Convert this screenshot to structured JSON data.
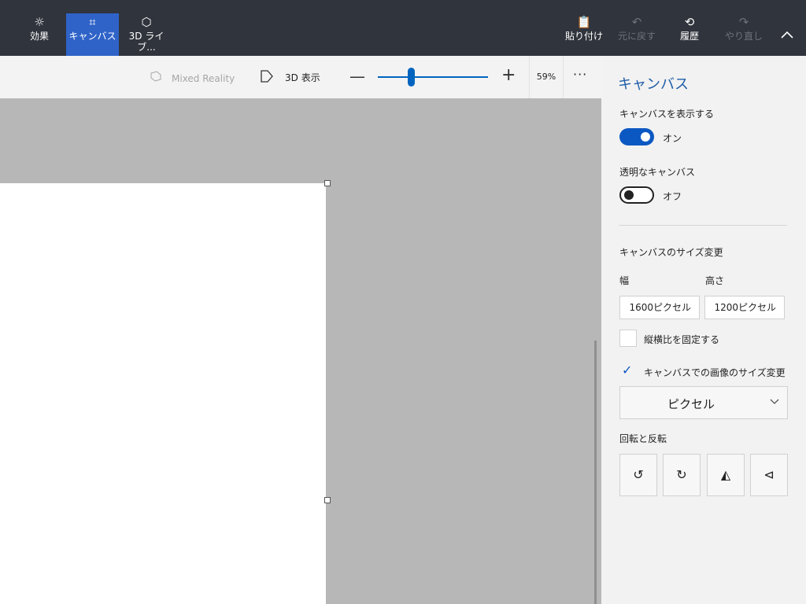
{
  "ribbon": {
    "tools": [
      {
        "label": "効果",
        "icon": "☼"
      },
      {
        "label": "キャンバス",
        "icon": "⌗"
      },
      {
        "label": "3D ライブ...",
        "icon": "⬡"
      }
    ],
    "actions": [
      {
        "label": "貼り付け",
        "icon": "📋"
      },
      {
        "label": "元に戻す",
        "icon": "↶"
      },
      {
        "label": "履歴",
        "icon": "⟲"
      },
      {
        "label": "やり直し",
        "icon": "↷"
      }
    ],
    "collapse_icon": "∧"
  },
  "toolbar": {
    "mixed_reality": "Mixed Reality",
    "view_3d": "3D 表示",
    "zoom_out": "—",
    "zoom_in": "+",
    "zoom_level": "59%",
    "zoom_value": 0.3,
    "more": "···"
  },
  "panel": {
    "title": "キャンバス",
    "show_canvas_label": "キャンバスを表示する",
    "show_canvas_state": "オン",
    "transparent_label": "透明なキャンバス",
    "transparent_state": "オフ",
    "resize_label": "キャンバスのサイズ変更",
    "width_label": "幅",
    "height_label": "高さ",
    "width_value": "1600ピクセル",
    "height_value": "1200ピクセル",
    "lock_aspect_label": "縦横比を固定する",
    "resize_image_label": "キャンバスでの画像のサイズ変更",
    "unit_value": "ピクセル",
    "rotate_flip_label": "回転と反転",
    "rotate_buttons": [
      "↺",
      "↻",
      "◭",
      "⊲"
    ]
  },
  "colors": {
    "ribbon_bg": "#30343c",
    "active_tool": "#2f63c8",
    "accent": "#0c58c3",
    "panel_title": "#1f5ea8",
    "workspace": "#b6b7b6"
  }
}
